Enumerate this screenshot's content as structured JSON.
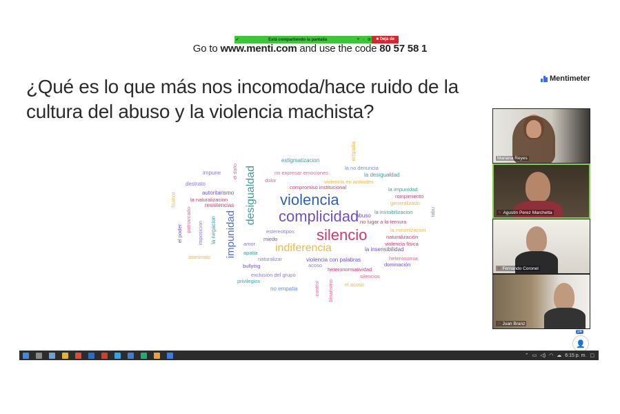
{
  "share_bar": {
    "message": "Está compartiendo la pantalla",
    "stop_label": "Deja de"
  },
  "menti": {
    "prefix": "Go to ",
    "url": "www.menti.com",
    "middle": " and use the code ",
    "code": "80 57 58 1"
  },
  "question": {
    "line1": "¿Qué es lo que más nos incomoda/hace ruido de la",
    "line2": "cultura del abuso y la violencia machista?"
  },
  "logo": {
    "name": "Mentimeter",
    "icon": "mentimeter-logo-icon",
    "accent": "#3f6be0"
  },
  "word_cloud": [
    {
      "text": "violencia",
      "color": "#2f5fbf"
    },
    {
      "text": "complicidad",
      "color": "#6f4fc7"
    },
    {
      "text": "silencio",
      "color": "#d2376b"
    },
    {
      "text": "indiferencia",
      "color": "#e6b94b"
    },
    {
      "text": "desigualdad",
      "color": "#3c9d9b"
    },
    {
      "text": "impunidad",
      "color": "#4e6fd1"
    },
    {
      "text": "estigmatizacion",
      "color": "#3c9d9b"
    },
    {
      "text": "empatia",
      "color": "#e6b94b"
    },
    {
      "text": "el daño",
      "color": "#e0678d"
    },
    {
      "text": "impune",
      "color": "#8a7ad6"
    },
    {
      "text": "no expresar emociones",
      "color": "#e0678d"
    },
    {
      "text": "la no denuncia",
      "color": "#6a8de0"
    },
    {
      "text": "la desigualdad",
      "color": "#3c9d9b"
    },
    {
      "text": "destrato",
      "color": "#8a7ad6"
    },
    {
      "text": "dolor",
      "color": "#e0678d"
    },
    {
      "text": "violencia en actitudes",
      "color": "#e6b94b"
    },
    {
      "text": "compromiso institucional",
      "color": "#d2376b"
    },
    {
      "text": "la impunidad",
      "color": "#3c9d9b"
    },
    {
      "text": "autoritarismo",
      "color": "#6f4fc7"
    },
    {
      "text": "la naturalizacion",
      "color": "#d2376b"
    },
    {
      "text": "rompimiento",
      "color": "#d2376b"
    },
    {
      "text": "generalizado",
      "color": "#e6b94b"
    },
    {
      "text": "humor",
      "color": "#e6b94b"
    },
    {
      "text": "resistencias",
      "color": "#d2376b"
    },
    {
      "text": "la invisibilizacion",
      "color": "#3c9d9b"
    },
    {
      "text": "tabu",
      "color": "#6a8de0"
    },
    {
      "text": "patriarcado",
      "color": "#e0678d"
    },
    {
      "text": "abuso",
      "color": "#6f4fc7"
    },
    {
      "text": "no lugar a la ternura",
      "color": "#d2376b"
    },
    {
      "text": "el poder",
      "color": "#6f4fc7"
    },
    {
      "text": "imposicion",
      "color": "#8a7ad6"
    },
    {
      "text": "la negacion",
      "color": "#3c9d9b"
    },
    {
      "text": "estereotipos",
      "color": "#8a7ad6"
    },
    {
      "text": "la minimizacion",
      "color": "#e6b94b"
    },
    {
      "text": "miedo",
      "color": "#6f4fc7"
    },
    {
      "text": "naturalización",
      "color": "#d2376b"
    },
    {
      "text": "violencia física",
      "color": "#d2376b"
    },
    {
      "text": "amor",
      "color": "#8a7ad6"
    },
    {
      "text": "la insensibilidad",
      "color": "#6f4fc7"
    },
    {
      "text": "asesinato",
      "color": "#e6b94b"
    },
    {
      "text": "apatia",
      "color": "#3c9d9b"
    },
    {
      "text": "naturalizar",
      "color": "#8a7ad6"
    },
    {
      "text": "violencia con palabras",
      "color": "#6f4fc7"
    },
    {
      "text": "acoso",
      "color": "#8a7ad6"
    },
    {
      "text": "heteronomia",
      "color": "#e0678d"
    },
    {
      "text": "dominación",
      "color": "#6f4fc7"
    },
    {
      "text": "bullying",
      "color": "#6f4fc7"
    },
    {
      "text": "heteronormatividad",
      "color": "#d2376b"
    },
    {
      "text": "exclusión del grupo",
      "color": "#8a7ad6"
    },
    {
      "text": "silencios",
      "color": "#e0678d"
    },
    {
      "text": "privilegios",
      "color": "#3c9d9b"
    },
    {
      "text": "el acoso",
      "color": "#e6b94b"
    },
    {
      "text": "no empatia",
      "color": "#6a8de0"
    },
    {
      "text": "control",
      "color": "#e0678d"
    },
    {
      "text": "binarismo",
      "color": "#e0678d"
    }
  ],
  "participants": [
    {
      "name": "Mariana Reyes",
      "active": false
    },
    {
      "name": "Agustin Perez Marchetta",
      "active": true
    },
    {
      "name": "Fernando Coronel",
      "active": false
    },
    {
      "name": "Juan Branz",
      "active": false
    }
  ],
  "participant_count": "24",
  "taskbar": {
    "time": "6:15 p. m."
  }
}
